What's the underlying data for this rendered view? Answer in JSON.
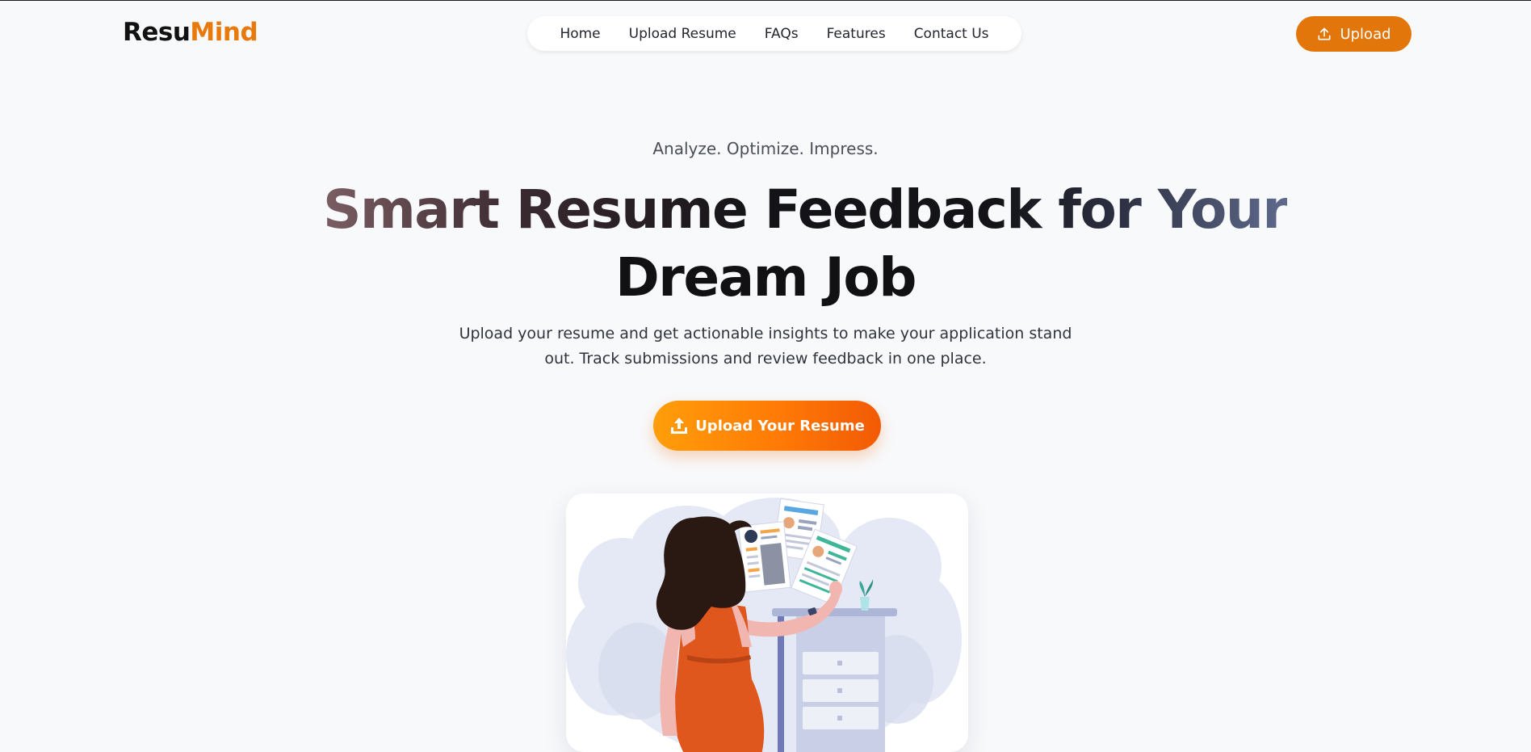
{
  "brand": {
    "part1": "Resu",
    "part2": "Mind"
  },
  "nav": {
    "items": [
      "Home",
      "Upload Resume",
      "FAQs",
      "Features",
      "Contact Us"
    ]
  },
  "header_button": {
    "label": "Upload",
    "icon": "upload-icon"
  },
  "hero": {
    "tagline": "Analyze. Optimize. Impress.",
    "title_line1": "Smart Resume Feedback for Your",
    "title_line2": "Dream Job",
    "subtitle": "Upload your resume and get actionable insights to make your application stand out. Track submissions and review feedback in one place.",
    "cta_label": "Upload Your Resume",
    "cta_icon": "upload-tray-icon"
  },
  "illustration": {
    "icon": "woman-reviewing-resumes-illustration"
  },
  "colors": {
    "accent": "#e2760b",
    "brand_orange": "#e87a0c",
    "cta_gradient_start": "#ff9e0a",
    "cta_gradient_end": "#f25a05",
    "background": "#f8f9fb"
  }
}
